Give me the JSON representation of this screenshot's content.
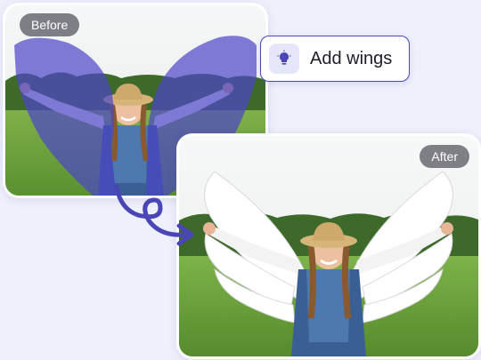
{
  "before": {
    "badge": "Before"
  },
  "after": {
    "badge": "After"
  },
  "prompt": {
    "label": "Add wings",
    "icon": "lightbulb-icon"
  },
  "colors": {
    "accent": "#4b46b8",
    "mask": "#5048c8",
    "background": "#eef0fb",
    "badge": "#5a5a64"
  }
}
